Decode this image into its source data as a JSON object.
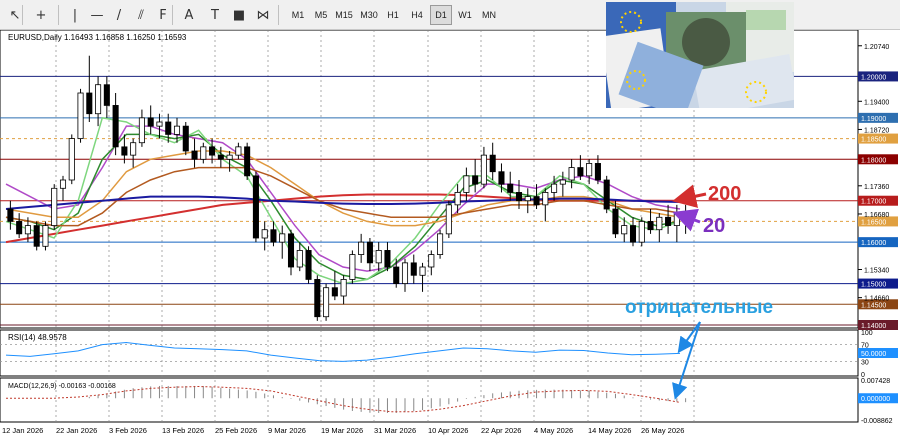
{
  "toolbar": {
    "tools": [
      {
        "name": "cursor-icon",
        "glyph": "↖"
      },
      {
        "name": "crosshair-icon",
        "glyph": "+"
      },
      {
        "name": "vertical-line-icon",
        "glyph": "|"
      },
      {
        "name": "horizontal-line-icon",
        "glyph": "—"
      },
      {
        "name": "trendline-icon",
        "glyph": "/"
      },
      {
        "name": "channel-icon",
        "glyph": "⫽"
      },
      {
        "name": "fibonacci-icon",
        "glyph": "F"
      },
      {
        "name": "text-icon",
        "glyph": "A"
      },
      {
        "name": "label-icon",
        "glyph": "T"
      },
      {
        "name": "rectangle-icon",
        "glyph": "■"
      },
      {
        "name": "shapes-icon",
        "glyph": "⋈"
      }
    ],
    "timeframes": [
      "M1",
      "M5",
      "M15",
      "M30",
      "H1",
      "H4",
      "D1",
      "W1",
      "MN"
    ],
    "active_timeframe": "D1"
  },
  "chart_data": {
    "type": "candlestick",
    "symbol_header": "EURUSD,Daily  1.16493 1.16858 1.16250 1.16593",
    "price_ticks": [
      "1.20740",
      "1.19400",
      "1.18720",
      "1.17360",
      "1.16680",
      "1.15340",
      "1.14660"
    ],
    "price_labels": [
      {
        "text": "1.20000",
        "color": "#1a237e"
      },
      {
        "text": "1.19000",
        "color": "#2e6fb0"
      },
      {
        "text": "1.18500",
        "color": "#e0a040"
      },
      {
        "text": "1.18000",
        "color": "#8b0000"
      },
      {
        "text": "1.17000",
        "color": "#b71c1c"
      },
      {
        "text": "1.16500",
        "color": "#e0a040"
      },
      {
        "text": "1.16000",
        "color": "#1565c0"
      },
      {
        "text": "1.15000",
        "color": "#0d1b8c"
      },
      {
        "text": "1.14500",
        "color": "#8b4513"
      },
      {
        "text": "1.14000",
        "color": "#6a1b2a"
      }
    ],
    "dates": [
      "12 Jan 2026",
      "22 Jan 2026",
      "3 Feb 2026",
      "13 Feb 2026",
      "25 Feb 2026",
      "9 Mar 2026",
      "19 Mar 2026",
      "31 Mar 2026",
      "10 Apr 2026",
      "22 Apr 2026",
      "4 May 2026",
      "14 May 2026",
      "26 May 2026"
    ],
    "ylim": [
      1.14,
      1.21
    ],
    "candles": [
      [
        1.168,
        1.17,
        1.163,
        1.165
      ],
      [
        1.165,
        1.167,
        1.161,
        1.162
      ],
      [
        1.162,
        1.166,
        1.16,
        1.164
      ],
      [
        1.164,
        1.165,
        1.158,
        1.159
      ],
      [
        1.159,
        1.165,
        1.158,
        1.164
      ],
      [
        1.164,
        1.174,
        1.163,
        1.173
      ],
      [
        1.173,
        1.176,
        1.17,
        1.175
      ],
      [
        1.175,
        1.186,
        1.174,
        1.185
      ],
      [
        1.185,
        1.197,
        1.184,
        1.196
      ],
      [
        1.196,
        1.205,
        1.189,
        1.191
      ],
      [
        1.191,
        1.2,
        1.188,
        1.198
      ],
      [
        1.198,
        1.2,
        1.19,
        1.193
      ],
      [
        1.193,
        1.196,
        1.181,
        1.183
      ],
      [
        1.183,
        1.186,
        1.179,
        1.181
      ],
      [
        1.181,
        1.185,
        1.178,
        1.184
      ],
      [
        1.184,
        1.192,
        1.183,
        1.19
      ],
      [
        1.19,
        1.193,
        1.186,
        1.188
      ],
      [
        1.188,
        1.191,
        1.185,
        1.189
      ],
      [
        1.189,
        1.191,
        1.184,
        1.186
      ],
      [
        1.186,
        1.19,
        1.184,
        1.188
      ],
      [
        1.188,
        1.189,
        1.181,
        1.182
      ],
      [
        1.182,
        1.185,
        1.178,
        1.18
      ],
      [
        1.18,
        1.184,
        1.179,
        1.183
      ],
      [
        1.183,
        1.185,
        1.179,
        1.181
      ],
      [
        1.181,
        1.183,
        1.178,
        1.18
      ],
      [
        1.18,
        1.182,
        1.177,
        1.181
      ],
      [
        1.181,
        1.184,
        1.18,
        1.183
      ],
      [
        1.183,
        1.184,
        1.175,
        1.176
      ],
      [
        1.176,
        1.177,
        1.16,
        1.161
      ],
      [
        1.161,
        1.165,
        1.158,
        1.163
      ],
      [
        1.163,
        1.165,
        1.159,
        1.16
      ],
      [
        1.16,
        1.164,
        1.156,
        1.162
      ],
      [
        1.162,
        1.163,
        1.152,
        1.154
      ],
      [
        1.154,
        1.16,
        1.153,
        1.158
      ],
      [
        1.158,
        1.159,
        1.15,
        1.151
      ],
      [
        1.151,
        1.152,
        1.141,
        1.142
      ],
      [
        1.142,
        1.15,
        1.141,
        1.149
      ],
      [
        1.149,
        1.153,
        1.146,
        1.147
      ],
      [
        1.147,
        1.152,
        1.145,
        1.151
      ],
      [
        1.151,
        1.158,
        1.15,
        1.157
      ],
      [
        1.157,
        1.162,
        1.155,
        1.16
      ],
      [
        1.16,
        1.161,
        1.153,
        1.155
      ],
      [
        1.155,
        1.16,
        1.153,
        1.158
      ],
      [
        1.158,
        1.16,
        1.153,
        1.154
      ],
      [
        1.154,
        1.156,
        1.149,
        1.15
      ],
      [
        1.15,
        1.156,
        1.148,
        1.155
      ],
      [
        1.155,
        1.157,
        1.15,
        1.152
      ],
      [
        1.152,
        1.155,
        1.148,
        1.154
      ],
      [
        1.154,
        1.158,
        1.152,
        1.157
      ],
      [
        1.157,
        1.163,
        1.156,
        1.162
      ],
      [
        1.162,
        1.17,
        1.161,
        1.169
      ],
      [
        1.169,
        1.174,
        1.167,
        1.172
      ],
      [
        1.172,
        1.178,
        1.17,
        1.176
      ],
      [
        1.176,
        1.18,
        1.172,
        1.174
      ],
      [
        1.174,
        1.183,
        1.173,
        1.181
      ],
      [
        1.181,
        1.184,
        1.175,
        1.177
      ],
      [
        1.177,
        1.179,
        1.172,
        1.174
      ],
      [
        1.174,
        1.177,
        1.17,
        1.172
      ],
      [
        1.172,
        1.175,
        1.168,
        1.17
      ],
      [
        1.17,
        1.173,
        1.167,
        1.171
      ],
      [
        1.171,
        1.174,
        1.168,
        1.169
      ],
      [
        1.169,
        1.173,
        1.165,
        1.172
      ],
      [
        1.172,
        1.176,
        1.17,
        1.174
      ],
      [
        1.174,
        1.177,
        1.171,
        1.175
      ],
      [
        1.175,
        1.18,
        1.173,
        1.178
      ],
      [
        1.178,
        1.181,
        1.175,
        1.176
      ],
      [
        1.176,
        1.18,
        1.174,
        1.179
      ],
      [
        1.179,
        1.181,
        1.174,
        1.175
      ],
      [
        1.175,
        1.176,
        1.167,
        1.168
      ],
      [
        1.168,
        1.17,
        1.161,
        1.162
      ],
      [
        1.162,
        1.166,
        1.16,
        1.164
      ],
      [
        1.164,
        1.166,
        1.159,
        1.16
      ],
      [
        1.16,
        1.166,
        1.159,
        1.165
      ],
      [
        1.165,
        1.168,
        1.162,
        1.163
      ],
      [
        1.163,
        1.167,
        1.16,
        1.166
      ],
      [
        1.166,
        1.169,
        1.162,
        1.164
      ],
      [
        1.164,
        1.169,
        1.16,
        1.167
      ],
      [
        1.165,
        1.169,
        1.162,
        1.166
      ]
    ],
    "ma_lines": [
      {
        "name": "200",
        "color": "#d32f2f",
        "values": [
          1.16,
          1.161,
          1.162,
          1.163,
          1.164,
          1.165,
          1.166,
          1.167,
          1.168,
          1.169,
          1.1695,
          1.17,
          1.1705,
          1.171,
          1.1713,
          1.1715,
          1.1715,
          1.1715,
          1.1715,
          1.1713,
          1.171,
          1.1706,
          1.1703,
          1.17,
          1.17,
          1.17,
          1.17,
          1.17,
          1.17
        ]
      },
      {
        "name": "20",
        "color": "#b04ac8",
        "values": [
          1.174,
          1.171,
          1.168,
          1.169,
          1.178,
          1.188,
          1.188,
          1.186,
          1.185,
          1.184,
          1.18,
          1.172,
          1.164,
          1.157,
          1.154,
          1.153,
          1.154,
          1.158,
          1.163,
          1.169,
          1.174,
          1.174,
          1.173,
          1.175,
          1.176,
          1.174,
          1.171,
          1.169,
          1.168
        ]
      },
      {
        "name": "green",
        "color": "#2e8b2e",
        "values": [
          1.166,
          1.165,
          1.163,
          1.167,
          1.18,
          1.186,
          1.186,
          1.185,
          1.186,
          1.181,
          1.178,
          1.17,
          1.161,
          1.155,
          1.152,
          1.151,
          1.154,
          1.159,
          1.166,
          1.173,
          1.175,
          1.172,
          1.171,
          1.175,
          1.174,
          1.17,
          1.166,
          1.164,
          1.165
        ]
      },
      {
        "name": "lightgreen",
        "color": "#7ed67e",
        "values": [
          1.165,
          1.163,
          1.161,
          1.17,
          1.19,
          1.189,
          1.186,
          1.184,
          1.187,
          1.18,
          1.176,
          1.166,
          1.156,
          1.152,
          1.15,
          1.151,
          1.155,
          1.161,
          1.169,
          1.176,
          1.176,
          1.171,
          1.171,
          1.176,
          1.174,
          1.168,
          1.164,
          1.163,
          1.165
        ]
      },
      {
        "name": "orange",
        "color": "#e09a40",
        "values": [
          1.168,
          1.167,
          1.166,
          1.166,
          1.17,
          1.177,
          1.18,
          1.181,
          1.182,
          1.182,
          1.181,
          1.178,
          1.174,
          1.17,
          1.167,
          1.165,
          1.164,
          1.164,
          1.165,
          1.167,
          1.169,
          1.17,
          1.17,
          1.171,
          1.171,
          1.17,
          1.168,
          1.167,
          1.166
        ]
      },
      {
        "name": "brown",
        "color": "#b35a20",
        "values": [
          1.166,
          1.165,
          1.164,
          1.164,
          1.167,
          1.172,
          1.175,
          1.177,
          1.178,
          1.178,
          1.178,
          1.176,
          1.173,
          1.17,
          1.168,
          1.167,
          1.166,
          1.166,
          1.166,
          1.167,
          1.168,
          1.169,
          1.169,
          1.17,
          1.17,
          1.169,
          1.168,
          1.168,
          1.167
        ]
      },
      {
        "name": "navy",
        "color": "#1a1aa0",
        "values": [
          1.168,
          1.1685,
          1.169,
          1.1695,
          1.17,
          1.1705,
          1.171,
          1.171,
          1.171,
          1.1708,
          1.1705,
          1.17,
          1.1698,
          1.1695,
          1.1693,
          1.1692,
          1.1692,
          1.1693,
          1.1695,
          1.1698,
          1.17,
          1.1702,
          1.1703,
          1.1705,
          1.1705,
          1.1703,
          1.17,
          1.1698,
          1.1697
        ]
      }
    ],
    "rsi": {
      "label": "RSI(14) 48.9578",
      "ticks": [
        "100",
        "70",
        "30",
        "0"
      ],
      "current_label": "50.0000",
      "values": [
        45,
        42,
        48,
        55,
        70,
        75,
        68,
        62,
        60,
        58,
        55,
        45,
        38,
        32,
        30,
        33,
        40,
        48,
        55,
        62,
        60,
        55,
        52,
        57,
        56,
        50,
        46,
        47,
        49
      ]
    },
    "macd": {
      "label": "MACD(12,26,9) -0.00163 -0.00168",
      "ticks": [
        "0.007428",
        "0.000000",
        "-0.008862"
      ],
      "current_label": "0.000000",
      "hist": [
        0,
        0,
        0,
        0,
        0.002,
        0.004,
        0.005,
        0.005,
        0.005,
        0.004,
        0.003,
        0.001,
        -0.001,
        -0.003,
        -0.005,
        -0.006,
        -0.006,
        -0.005,
        -0.003,
        0,
        0.002,
        0.003,
        0.0035,
        0.0035,
        0.003,
        0.002,
        0,
        -0.001,
        -0.0016
      ],
      "signal": [
        0,
        0,
        0,
        0.0005,
        0.0015,
        0.003,
        0.004,
        0.0045,
        0.0048,
        0.0045,
        0.004,
        0.003,
        0.001,
        -0.001,
        -0.003,
        -0.0045,
        -0.0055,
        -0.0055,
        -0.0045,
        -0.003,
        -0.001,
        0.001,
        0.0025,
        0.003,
        0.0032,
        0.0028,
        0.0015,
        0,
        -0.0017
      ]
    },
    "annotations": [
      {
        "text": "200",
        "color": "#d32f2f"
      },
      {
        "text": "20",
        "color": "#7b2fbe"
      },
      {
        "text": "отрицательные",
        "color": "#2aa0e0"
      }
    ]
  }
}
